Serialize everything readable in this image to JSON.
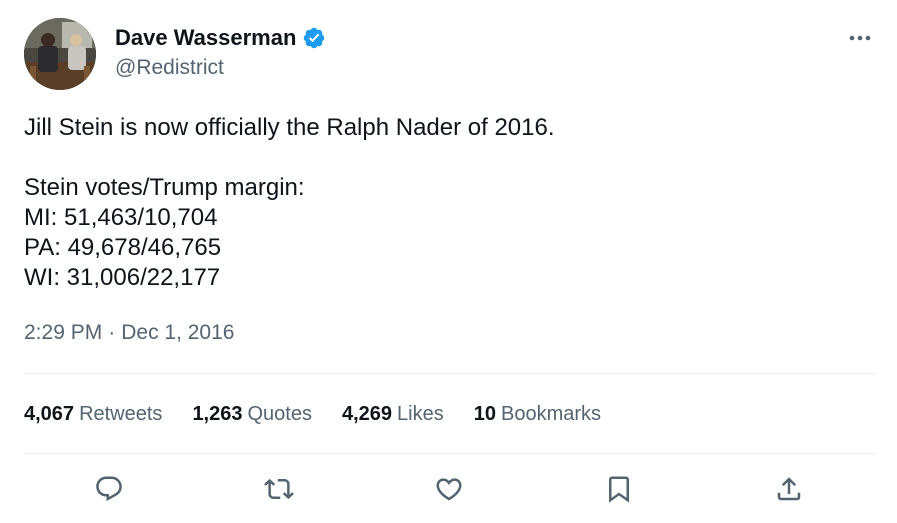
{
  "author": {
    "display_name": "Dave Wasserman",
    "handle": "@Redistrict",
    "verified_icon": "verified-badge-icon",
    "verified_color": "#1d9bf0"
  },
  "tweet": {
    "text": "Jill Stein is now officially the Ralph Nader of 2016.\n\nStein votes/Trump margin:\nMI: 51,463/10,704\nPA: 49,678/46,765\nWI: 31,006/22,177",
    "time": "2:29 PM",
    "separator": "·",
    "date": "Dec 1, 2016"
  },
  "stats": {
    "retweets_count": "4,067",
    "retweets_label": "Retweets",
    "quotes_count": "1,263",
    "quotes_label": "Quotes",
    "likes_count": "4,269",
    "likes_label": "Likes",
    "bookmarks_count": "10",
    "bookmarks_label": "Bookmarks"
  },
  "actions": [
    {
      "name": "reply",
      "icon": "reply-icon"
    },
    {
      "name": "retweet",
      "icon": "retweet-icon"
    },
    {
      "name": "like",
      "icon": "heart-icon"
    },
    {
      "name": "bookmark",
      "icon": "bookmark-icon"
    },
    {
      "name": "share",
      "icon": "share-icon"
    }
  ],
  "colors": {
    "text_primary": "#0f1419",
    "text_secondary": "#536471",
    "divider": "#eff3f4",
    "accent": "#1d9bf0"
  }
}
